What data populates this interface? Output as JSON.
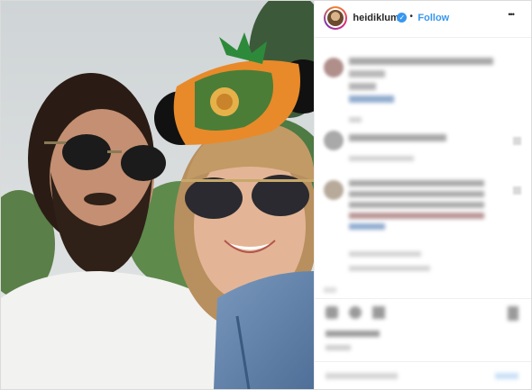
{
  "header": {
    "username": "heidiklum",
    "separator": "•",
    "follow_label": "Follow",
    "more_label": "•••",
    "verified_color": "#3897f0",
    "follow_color": "#3897f0"
  },
  "icons": {
    "verified": "verified-badge-icon",
    "more": "more-options-icon",
    "like": "heart-icon",
    "comment": "comment-icon",
    "share": "share-icon",
    "save": "bookmark-icon"
  }
}
